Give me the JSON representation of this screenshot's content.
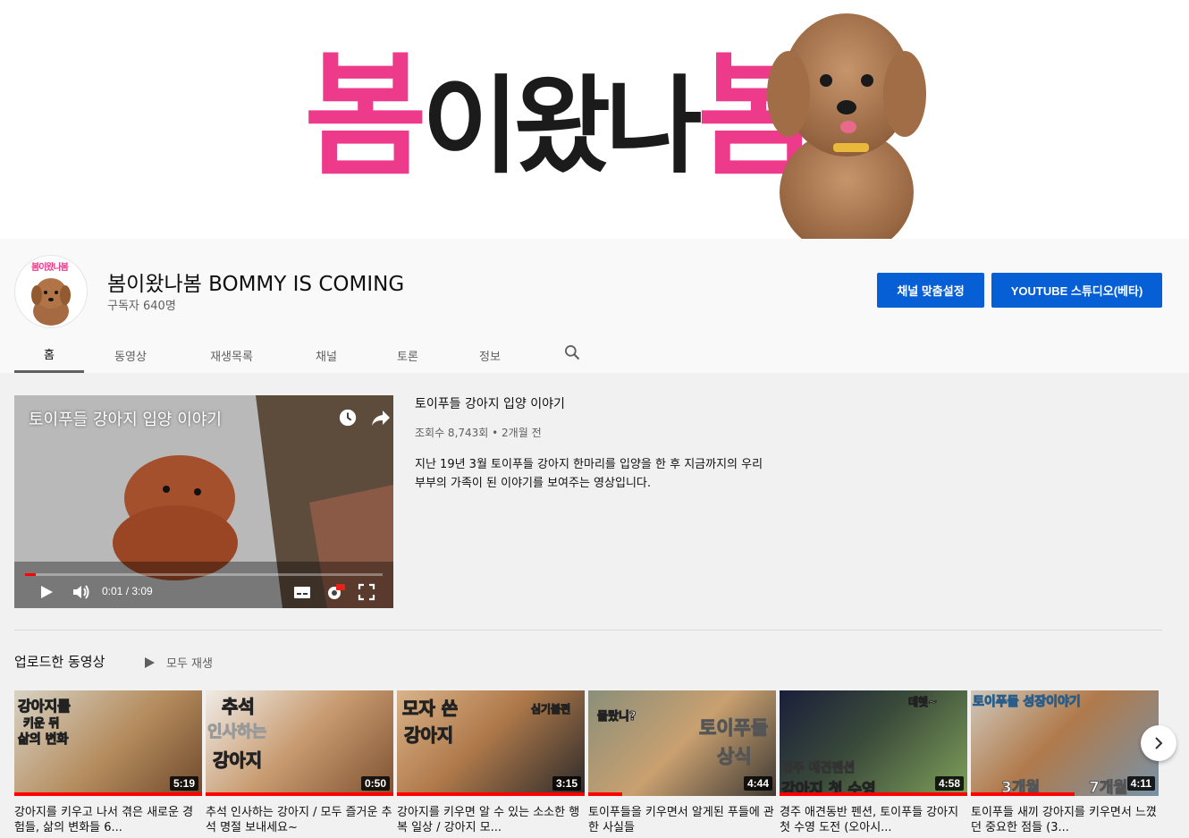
{
  "banner": {
    "part1": "봄",
    "part2": "이왔나",
    "part3": "봄"
  },
  "channel": {
    "avatar_text": "봄이왔나봄",
    "name": "봄이왔나봄 BOMMY IS COMING",
    "subscribers": "구독자 640명"
  },
  "actions": {
    "customize": "채널 맞춤설정",
    "studio": "YOUTUBE 스튜디오(베타)"
  },
  "tabs": [
    "홈",
    "동영상",
    "재생목록",
    "채널",
    "토론",
    "정보"
  ],
  "featured": {
    "player_title": "토이푸들 강아지 입양 이야기",
    "time": "0:01 / 3:09",
    "progress": 0.005,
    "title": "토이푸들 강아지 입양 이야기",
    "meta": "조회수 8,743회 • 2개월 전",
    "description": "지난 19년 3월 토이푸들 강아지 한마리를 입양을 한 후 지금까지의 우리 부부의 가족이 된 이야기를 보여주는 영상입니다."
  },
  "shelf": {
    "title": "업로드한 동영상",
    "play_all": "모두 재생"
  },
  "videos": [
    {
      "duration": "5:19",
      "progress": 1.0,
      "title": "강아지를 키우고 나서 겪은 새로운 경험들, 삶의 변화들 6...",
      "caption1": "강아지를",
      "caption2": "키운 뒤",
      "caption3": "삶의 변화"
    },
    {
      "duration": "0:50",
      "progress": 1.0,
      "title": "추석 인사하는 강아지 / 모두 즐거운 추석 명절 보내세요~",
      "caption1": "추석",
      "caption2": "인사하는",
      "caption3": "강아지"
    },
    {
      "duration": "3:15",
      "progress": 1.0,
      "title": "강아지를 키우면 알 수 있는 소소한 행복 일상 / 강아지 모...",
      "caption1": "모자 쓴",
      "caption2": "강아지",
      "caption3": "심기불편"
    },
    {
      "duration": "4:44",
      "progress": 0.18,
      "title": "토이푸들을 키우면서 알게된 푸들에 관한 사실들",
      "caption1": "몰랐니?",
      "caption2": "토이푸들",
      "caption3": "상식"
    },
    {
      "duration": "4:58",
      "progress": 1.0,
      "title": "경주 애견동반 펜션, 토이푸들 강아지 첫 수영 도전 (오아시...",
      "caption1": "데헷~",
      "caption2": "경주 애견펜션",
      "caption3": "강아지 첫 수영"
    },
    {
      "duration": "4:11",
      "progress": 0.55,
      "title": "토이푸들 새끼 강아지를 키우면서 느꼈던 중요한 점들 (3...",
      "caption1": "토이푸들 성장이야기",
      "caption2": "3개월",
      "caption3": "7개월"
    }
  ]
}
